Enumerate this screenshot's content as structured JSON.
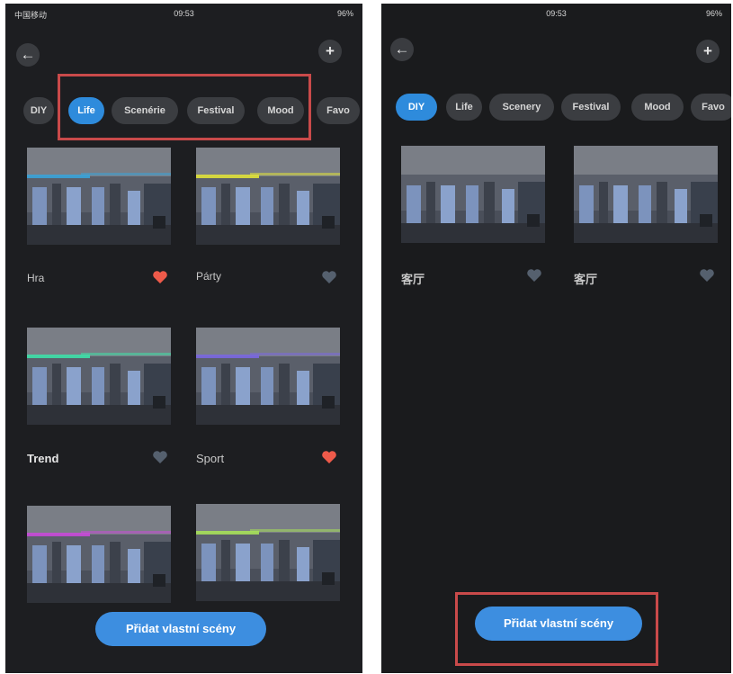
{
  "status_bar": {
    "left": {
      "carrier": "中国移动"
    },
    "time": {
      "value": "09:53"
    },
    "right": {
      "battery": "96%"
    }
  },
  "left_screen": {
    "back_icon": "←",
    "add_icon": "+",
    "tabs": [
      {
        "label": "DIY"
      },
      {
        "label": "Life"
      },
      {
        "label": "Scenérie"
      },
      {
        "label": "Festival"
      },
      {
        "label": "Mood"
      },
      {
        "label": "Favo"
      }
    ],
    "active_tab": "Life",
    "scenes": [
      {
        "label": "Hra",
        "favorite": true,
        "accent": "#3aa3d8"
      },
      {
        "label": "Párty",
        "favorite": false,
        "accent": "#e0e23a"
      },
      {
        "label": "Trend",
        "favorite": false,
        "accent": "#3ee0a8"
      },
      {
        "label": "Sport",
        "favorite": true,
        "accent": "#7a68e0"
      },
      {
        "label": "",
        "favorite": false,
        "accent": "#c84ad8"
      },
      {
        "label": "",
        "favorite": false,
        "accent": "#a6e05a"
      }
    ],
    "add_button": "Přidat vlastní scény"
  },
  "right_screen": {
    "back_icon": "←",
    "add_icon": "+",
    "tabs": [
      {
        "label": "DIY"
      },
      {
        "label": "Life"
      },
      {
        "label": "Scenery"
      },
      {
        "label": "Festival"
      },
      {
        "label": "Mood"
      },
      {
        "label": "Favo"
      }
    ],
    "active_tab": "DIY",
    "scenes": [
      {
        "label": "客厅",
        "favorite": false
      },
      {
        "label": "客厅",
        "favorite": false
      }
    ],
    "add_button": "Přidat vlastní scény"
  },
  "colors": {
    "background": "#1d1e21",
    "tab_inactive": "#3b3d41",
    "tab_active": "#2e8bdc",
    "button": "#3d8ee0",
    "heart_active": "#ee5a4a",
    "heart_inactive": "#55606e",
    "highlight_box": "#c94a4a"
  }
}
